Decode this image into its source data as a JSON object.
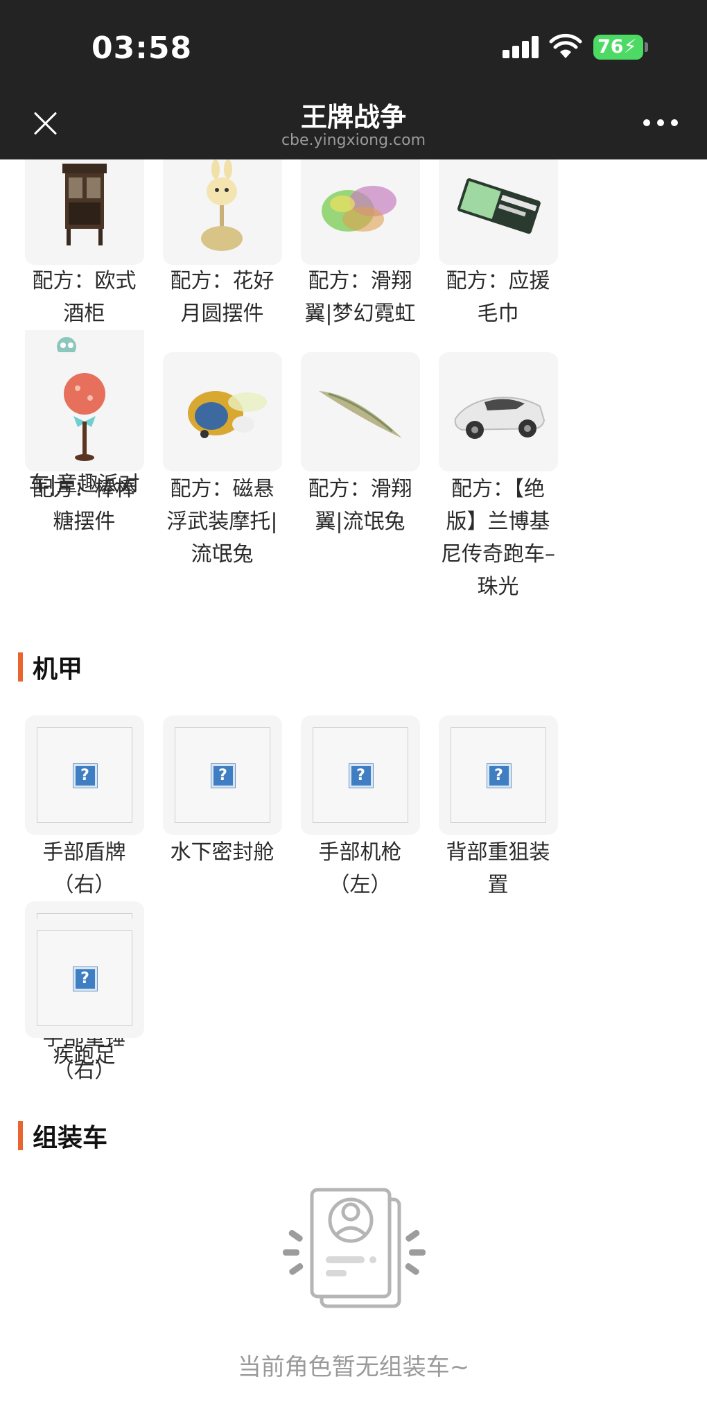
{
  "status_bar": {
    "time": "03:58",
    "battery": "76"
  },
  "nav": {
    "title": "王牌战争",
    "subtitle": "cbe.yingxiong.com"
  },
  "recipe_items_row1": [
    {
      "label": "配方：欧式酒柜",
      "icon": "wine-cabinet"
    },
    {
      "label": "配方：花好月圆摆件",
      "icon": "rabbit-ornament"
    },
    {
      "label": "配方：滑翔翼|梦幻霓虹",
      "icon": "glider-neon"
    },
    {
      "label": "配方：应援毛巾",
      "icon": "towel"
    },
    {
      "label": "配方：电动车|童趣派对",
      "icon": "scooter"
    }
  ],
  "recipe_items_row2": [
    {
      "label": "配方：棒棒糖摆件",
      "icon": "lollipop"
    },
    {
      "label": "配方：磁悬浮武装摩托|流氓兔",
      "icon": "hover-bike"
    },
    {
      "label": "配方：滑翔翼|流氓兔",
      "icon": "glider-blade"
    },
    {
      "label": "配方：【绝版】兰博基尼传奇跑车–珠光",
      "icon": "sports-car"
    }
  ],
  "mech_section": {
    "title": "机甲",
    "items": [
      {
        "label": "手部盾牌（右）"
      },
      {
        "label": "水下密封舱"
      },
      {
        "label": "手部机枪（左）"
      },
      {
        "label": "背部重狙装置"
      },
      {
        "label": "手部重锤（右）"
      },
      {
        "label": "疾跑足"
      }
    ],
    "placeholder_glyph": "?"
  },
  "vehicle_section": {
    "title": "组装车",
    "empty_text": "当前角色暂无组装车~"
  },
  "colors": {
    "accent": "#e8662e",
    "topbar": "#232323",
    "battery": "#4cd964"
  }
}
